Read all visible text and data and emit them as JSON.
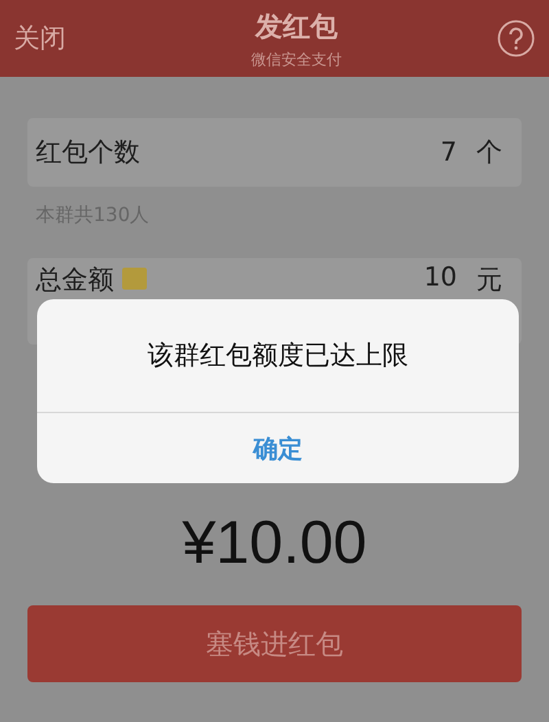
{
  "header": {
    "close": "关闭",
    "title": "发红包",
    "subtitle": "微信安全支付"
  },
  "count_row": {
    "label": "红包个数",
    "value": "7",
    "unit": "个"
  },
  "group_hint": "本群共130人",
  "amount_row": {
    "label": "总金额",
    "value": "10",
    "unit": "元"
  },
  "total": "¥10.00",
  "submit_button": "塞钱进红包",
  "dialog": {
    "message": "该群红包额度已达上限",
    "confirm": "确定"
  }
}
